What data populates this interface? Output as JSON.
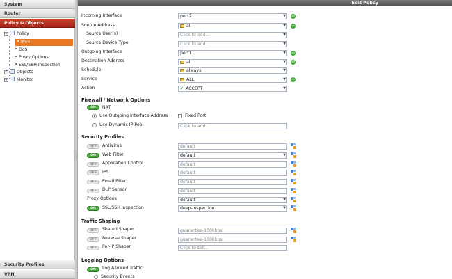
{
  "colors": {
    "nav_active": "#b93123",
    "tree_selected": "#e87722",
    "toggle_on": "#48a63c",
    "add_icon": "#3fa535",
    "header_bar": "#5e5e5e"
  },
  "nav": {
    "system": "System",
    "router": "Router",
    "policy_objects": "Policy & Objects",
    "security_profiles": "Security Profiles",
    "vpn": "VPN"
  },
  "tree": {
    "policy": "Policy",
    "ipv4": "IPv4",
    "dos": "DoS",
    "proxy_options": "Proxy Options",
    "ssl_ssh": "SSL/SSH Inspection",
    "objects": "Objects",
    "monitor": "Monitor"
  },
  "header": {
    "title": "Edit Policy"
  },
  "form": {
    "incoming_interface": {
      "label": "Incoming Interface",
      "value": "port2"
    },
    "source_address": {
      "label": "Source Address",
      "value": "all"
    },
    "source_users": {
      "label": "Source User(s)",
      "placeholder": "Click to add..."
    },
    "source_device_type": {
      "label": "Source Device Type",
      "placeholder": "Click to add..."
    },
    "outgoing_interface": {
      "label": "Outgoing Interface",
      "value": "port1"
    },
    "destination_address": {
      "label": "Destination Address",
      "value": "all"
    },
    "schedule": {
      "label": "Schedule",
      "value": "always"
    },
    "service": {
      "label": "Service",
      "value": "ALL"
    },
    "action": {
      "label": "Action",
      "value": "ACCEPT"
    }
  },
  "firewall": {
    "title": "Firewall / Network Options",
    "nat_label": "NAT",
    "use_outgoing": "Use Outgoing Interface Address",
    "fixed_port": "Fixed Port",
    "use_dynamic": "Use Dynamic IP Pool",
    "ip_pool_placeholder": "Click to add..."
  },
  "toggles": {
    "on": "ON",
    "off": "OFF"
  },
  "security_profiles": {
    "title": "Security Profiles",
    "items": [
      {
        "label": "AntiVirus",
        "state": "off",
        "value": "default",
        "select": false
      },
      {
        "label": "Web Filter",
        "state": "on",
        "value": "default",
        "select": true
      },
      {
        "label": "Application Control",
        "state": "off",
        "value": "default",
        "select": false
      },
      {
        "label": "IPS",
        "state": "off",
        "value": "default",
        "select": false
      },
      {
        "label": "Email Filter",
        "state": "off",
        "value": "default",
        "select": false
      },
      {
        "label": "DLP Sensor",
        "state": "off",
        "value": "default",
        "select": false
      },
      {
        "label": "Proxy Options",
        "state": null,
        "value": "default",
        "select": true
      },
      {
        "label": "SSL/SSH Inspection",
        "state": "on",
        "value": "deep-inspection",
        "select": true
      }
    ]
  },
  "traffic_shaping": {
    "title": "Traffic Shaping",
    "items": [
      {
        "label": "Shared Shaper",
        "state": "off",
        "value": "guarantee-100kbps"
      },
      {
        "label": "Reverse Shaper",
        "state": "off",
        "value": "guarantee-100kbps"
      },
      {
        "label": "Per-IP Shaper",
        "state": "off",
        "value": "Click to set..."
      }
    ]
  },
  "logging": {
    "title": "Logging Options",
    "log_allowed": "Log Allowed Traffic",
    "security_events": "Security Events"
  }
}
